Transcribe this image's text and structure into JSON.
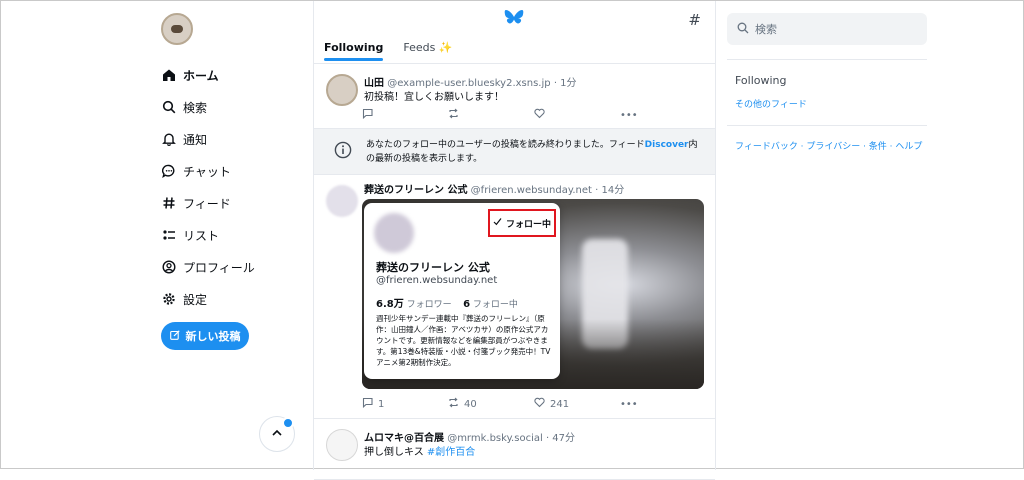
{
  "nav": {
    "items": [
      {
        "label": "ホーム",
        "icon": "home-icon"
      },
      {
        "label": "検索",
        "icon": "search-icon"
      },
      {
        "label": "通知",
        "icon": "bell-icon"
      },
      {
        "label": "チャット",
        "icon": "chat-icon"
      },
      {
        "label": "フィード",
        "icon": "hash-icon"
      },
      {
        "label": "リスト",
        "icon": "list-icon"
      },
      {
        "label": "プロフィール",
        "icon": "profile-icon"
      },
      {
        "label": "設定",
        "icon": "gear-icon"
      }
    ],
    "new_post_label": "新しい投稿"
  },
  "header": {
    "tabs": [
      {
        "label": "Following"
      },
      {
        "label": "Feeds ✨"
      }
    ]
  },
  "posts": [
    {
      "name": "山田",
      "handle": "@example-user.bluesky2.xsns.jp",
      "time": "· 1分",
      "text": "初投稿！宜しくお願いします！",
      "replies": "",
      "reposts": "",
      "likes": ""
    },
    {
      "name": "葬送のフリーレン 公式",
      "handle": "@frieren.websunday.net",
      "time": "· 14分",
      "replies": "1",
      "reposts": "40",
      "likes": "241"
    },
    {
      "name": "ムロマキ@百合展",
      "handle": "@mrmk.bsky.social",
      "time": "· 47分",
      "text": "押し倒しキス",
      "hashtag": "#創作百合"
    }
  ],
  "notice": {
    "text_before": "あなたのフォロー中のユーザーの投稿を読み終わりました。フィード",
    "link": "Discover",
    "text_after": "内の最新の投稿を表示します。"
  },
  "profile_card": {
    "follow_label": "フォロー中",
    "name": "葬送のフリーレン 公式",
    "handle": "@frieren.websunday.net",
    "followers_count": "6.8万",
    "followers_label": "フォロワー",
    "following_count": "6",
    "following_label": "フォロー中",
    "bio": "週刊少年サンデー連載中『葬送のフリーレン』（原作：山田鐘人／作画：アベツカサ）の原作公式アカウントです。更新情報などを編集部員がつぶやきます。第13巻&特装版・小説・付箋ブック発売中！TVアニメ第2期制作決定。"
  },
  "right": {
    "search_placeholder": "検索",
    "following_label": "Following",
    "other_feeds": "その他のフィード",
    "footer_links": "フィードバック · プライバシー · 条件 · ヘルプ"
  },
  "colors": {
    "accent": "#1d8ff0",
    "highlight_box": "#e0161f"
  }
}
